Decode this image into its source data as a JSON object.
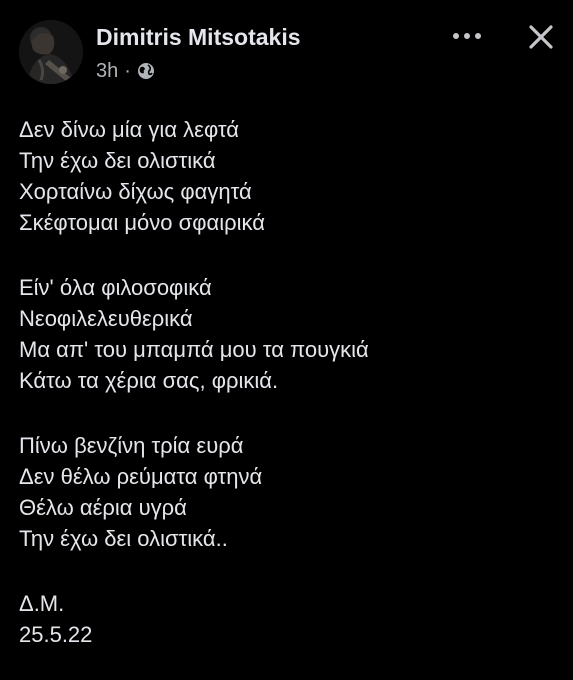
{
  "post": {
    "author": "Dimitris Mitsotakis",
    "time": "3h",
    "separator": "·",
    "audience_icon": "globe-icon",
    "more_icon": "more-options-icon",
    "close_icon": "close-icon",
    "stanza1": [
      "Δεν δίνω μία για λεφτά",
      "Την έχω δει ολιστικά",
      "Χορταίνω δίχως φαγητά",
      "Σκέφτομαι μόνο σφαιρικά"
    ],
    "stanza2": [
      "Είν' όλα φιλοσοφικά",
      "Νεοφιλελευθερικά",
      "Μα απ' του μπαμπά μου τα πουγκιά",
      "Κάτω τα χέρια σας, φρικιά."
    ],
    "stanza3": [
      "Πίνω βενζίνη τρία ευρά",
      "Δεν θέλω ρεύματα φτηνά",
      "Θέλω αέρια υγρά",
      "Την έχω δει ολιστικά.."
    ],
    "signature": "Δ.Μ.",
    "date": "25.5.22"
  }
}
